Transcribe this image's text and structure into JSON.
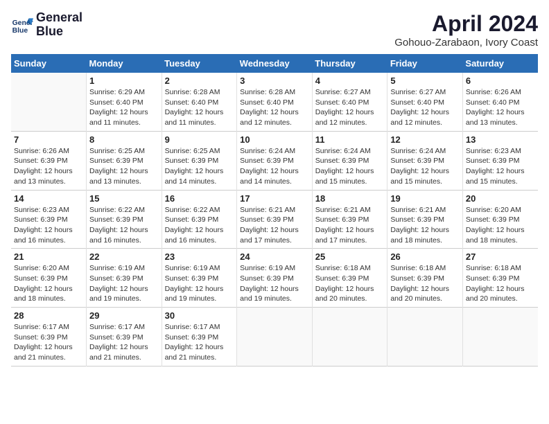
{
  "header": {
    "logo_line1": "General",
    "logo_line2": "Blue",
    "title": "April 2024",
    "subtitle": "Gohouo-Zarabaon, Ivory Coast"
  },
  "columns": [
    "Sunday",
    "Monday",
    "Tuesday",
    "Wednesday",
    "Thursday",
    "Friday",
    "Saturday"
  ],
  "weeks": [
    [
      null,
      {
        "num": "1",
        "sunrise": "6:29 AM",
        "sunset": "6:40 PM",
        "daylight": "12 hours and 11 minutes."
      },
      {
        "num": "2",
        "sunrise": "6:28 AM",
        "sunset": "6:40 PM",
        "daylight": "12 hours and 11 minutes."
      },
      {
        "num": "3",
        "sunrise": "6:28 AM",
        "sunset": "6:40 PM",
        "daylight": "12 hours and 12 minutes."
      },
      {
        "num": "4",
        "sunrise": "6:27 AM",
        "sunset": "6:40 PM",
        "daylight": "12 hours and 12 minutes."
      },
      {
        "num": "5",
        "sunrise": "6:27 AM",
        "sunset": "6:40 PM",
        "daylight": "12 hours and 12 minutes."
      },
      {
        "num": "6",
        "sunrise": "6:26 AM",
        "sunset": "6:40 PM",
        "daylight": "12 hours and 13 minutes."
      }
    ],
    [
      {
        "num": "7",
        "sunrise": "6:26 AM",
        "sunset": "6:39 PM",
        "daylight": "12 hours and 13 minutes."
      },
      {
        "num": "8",
        "sunrise": "6:25 AM",
        "sunset": "6:39 PM",
        "daylight": "12 hours and 13 minutes."
      },
      {
        "num": "9",
        "sunrise": "6:25 AM",
        "sunset": "6:39 PM",
        "daylight": "12 hours and 14 minutes."
      },
      {
        "num": "10",
        "sunrise": "6:24 AM",
        "sunset": "6:39 PM",
        "daylight": "12 hours and 14 minutes."
      },
      {
        "num": "11",
        "sunrise": "6:24 AM",
        "sunset": "6:39 PM",
        "daylight": "12 hours and 15 minutes."
      },
      {
        "num": "12",
        "sunrise": "6:24 AM",
        "sunset": "6:39 PM",
        "daylight": "12 hours and 15 minutes."
      },
      {
        "num": "13",
        "sunrise": "6:23 AM",
        "sunset": "6:39 PM",
        "daylight": "12 hours and 15 minutes."
      }
    ],
    [
      {
        "num": "14",
        "sunrise": "6:23 AM",
        "sunset": "6:39 PM",
        "daylight": "12 hours and 16 minutes."
      },
      {
        "num": "15",
        "sunrise": "6:22 AM",
        "sunset": "6:39 PM",
        "daylight": "12 hours and 16 minutes."
      },
      {
        "num": "16",
        "sunrise": "6:22 AM",
        "sunset": "6:39 PM",
        "daylight": "12 hours and 16 minutes."
      },
      {
        "num": "17",
        "sunrise": "6:21 AM",
        "sunset": "6:39 PM",
        "daylight": "12 hours and 17 minutes."
      },
      {
        "num": "18",
        "sunrise": "6:21 AM",
        "sunset": "6:39 PM",
        "daylight": "12 hours and 17 minutes."
      },
      {
        "num": "19",
        "sunrise": "6:21 AM",
        "sunset": "6:39 PM",
        "daylight": "12 hours and 18 minutes."
      },
      {
        "num": "20",
        "sunrise": "6:20 AM",
        "sunset": "6:39 PM",
        "daylight": "12 hours and 18 minutes."
      }
    ],
    [
      {
        "num": "21",
        "sunrise": "6:20 AM",
        "sunset": "6:39 PM",
        "daylight": "12 hours and 18 minutes."
      },
      {
        "num": "22",
        "sunrise": "6:19 AM",
        "sunset": "6:39 PM",
        "daylight": "12 hours and 19 minutes."
      },
      {
        "num": "23",
        "sunrise": "6:19 AM",
        "sunset": "6:39 PM",
        "daylight": "12 hours and 19 minutes."
      },
      {
        "num": "24",
        "sunrise": "6:19 AM",
        "sunset": "6:39 PM",
        "daylight": "12 hours and 19 minutes."
      },
      {
        "num": "25",
        "sunrise": "6:18 AM",
        "sunset": "6:39 PM",
        "daylight": "12 hours and 20 minutes."
      },
      {
        "num": "26",
        "sunrise": "6:18 AM",
        "sunset": "6:39 PM",
        "daylight": "12 hours and 20 minutes."
      },
      {
        "num": "27",
        "sunrise": "6:18 AM",
        "sunset": "6:39 PM",
        "daylight": "12 hours and 20 minutes."
      }
    ],
    [
      {
        "num": "28",
        "sunrise": "6:17 AM",
        "sunset": "6:39 PM",
        "daylight": "12 hours and 21 minutes."
      },
      {
        "num": "29",
        "sunrise": "6:17 AM",
        "sunset": "6:39 PM",
        "daylight": "12 hours and 21 minutes."
      },
      {
        "num": "30",
        "sunrise": "6:17 AM",
        "sunset": "6:39 PM",
        "daylight": "12 hours and 21 minutes."
      },
      null,
      null,
      null,
      null
    ]
  ]
}
